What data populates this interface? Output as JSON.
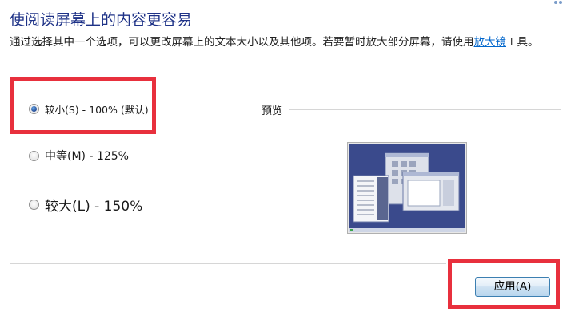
{
  "window": {
    "title": "使阅读屏幕上的内容更容易"
  },
  "description": {
    "text": "通过选择其中一个选项，可以更改屏幕上的文本大小以及其他项。若要暂时放大部分屏幕，请使用",
    "link_label": "放大镜",
    "suffix": "工具。"
  },
  "options": [
    {
      "label": "较小(S) - 100% (默认)",
      "checked": true
    },
    {
      "label": "中等(M) - 125%",
      "checked": false
    },
    {
      "label": "较大(L) - 150%",
      "checked": false
    }
  ],
  "preview": {
    "label": "预览",
    "image_icon": "desktop-preview-icon"
  },
  "footer": {
    "apply_label": "应用(A)"
  },
  "colors": {
    "title": "#1e3287",
    "link": "#0066cc",
    "highlight": "#e8303d",
    "preview_desktop": "#3a4a8c"
  }
}
